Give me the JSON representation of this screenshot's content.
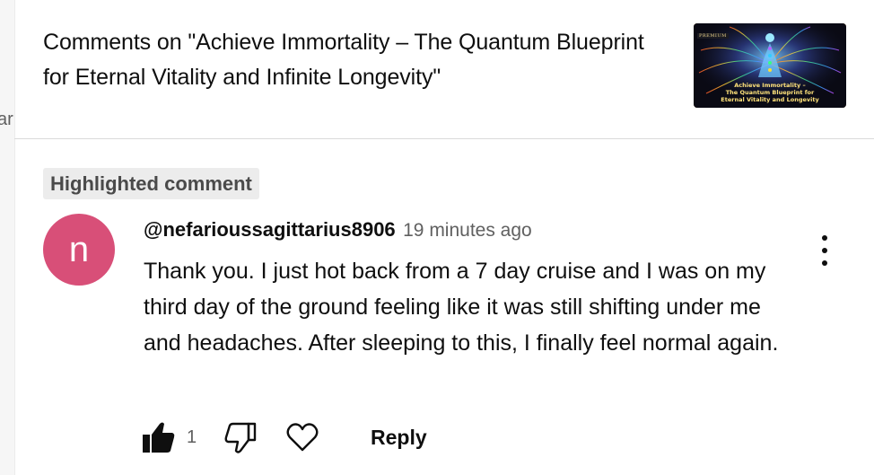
{
  "side_panel": {
    "stub_text": "ar"
  },
  "header": {
    "title": "Comments on \"Achieve Immortality – The Quantum Blueprint for Eternal Vitality and Infinite Longevity\"",
    "thumbnail": {
      "badge": "PREMIUM",
      "line1": "Achieve Immortality –",
      "line2": "The Quantum Blueprint for",
      "line3": "Eternal Vitality and Longevity"
    }
  },
  "comment": {
    "chip_label": "Highlighted comment",
    "avatar_letter": "n",
    "avatar_color": "#d84f78",
    "author": "@nefarioussagittarius8906",
    "time": "19 minutes ago",
    "text": "Thank you. I just hot back from a 7 day cruise and I was on my third day of the ground feeling like it was still shifting under me and headaches. After sleeping to this, I finally feel normal again.",
    "like_count": "1",
    "reply_label": "Reply",
    "icons": [
      "thumbs-up-icon",
      "thumbs-down-icon",
      "heart-icon",
      "more-vert-icon"
    ]
  }
}
